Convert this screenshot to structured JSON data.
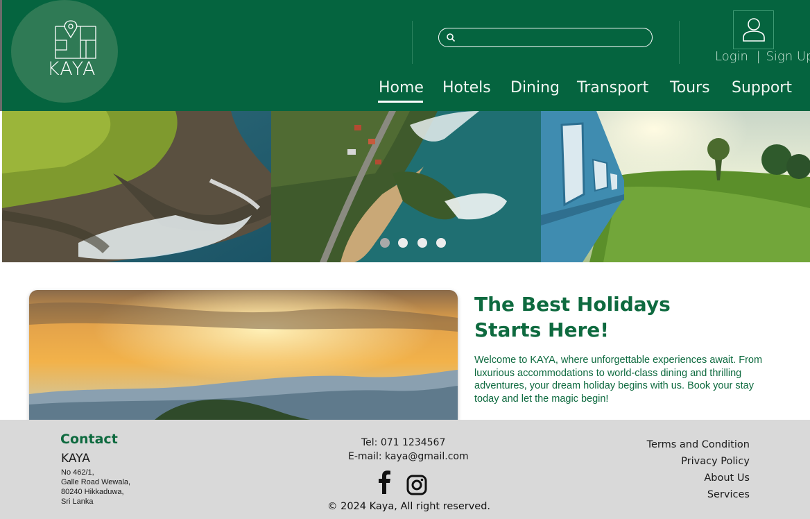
{
  "brand": {
    "name": "KAYA",
    "color": "#05643f"
  },
  "header": {
    "search": {
      "placeholder": ""
    },
    "auth": {
      "login": "Login",
      "separator": "|",
      "signup": "Sign Up"
    },
    "nav": [
      "Home",
      "Hotels",
      "Dining",
      "Transport",
      "Tours",
      "Support"
    ],
    "active_nav": "Home"
  },
  "carousel": {
    "slides": [
      "coastal-cliffs",
      "aerial-peninsula",
      "train-hill-country"
    ],
    "dot_count": 4,
    "active_dot": 0
  },
  "intro": {
    "title_line1": "The Best Holidays",
    "title_line2": "Starts Here!",
    "body": "Welcome to KAYA, where unforgettable experiences await. From luxurious accommodations to world-class dining and thrilling adventures, your dream holiday begins with us. Book your stay today and let the magic begin!"
  },
  "footer": {
    "contact_title": "Contact",
    "company": "KAYA",
    "address": [
      "No 462/1,",
      "Galle Road Wewala,",
      "80240 Hikkaduwa,",
      "Sri Lanka"
    ],
    "tel": "Tel: 071 1234567",
    "email": "E-mail: kaya@gmail.com",
    "social": [
      "facebook-icon",
      "instagram-icon"
    ],
    "copyright": "© 2024 Kaya, All right reserved.",
    "links": [
      "Terms and Condition",
      "Privacy Policy",
      "About Us",
      "Services"
    ]
  }
}
